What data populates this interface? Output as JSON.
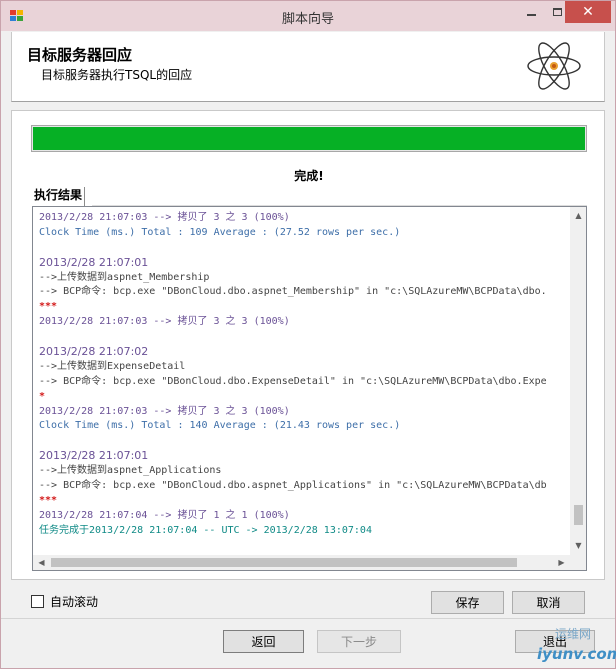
{
  "window": {
    "title": "脚本向导",
    "close_glyph": "✕"
  },
  "header": {
    "title": "目标服务器回应",
    "subtitle": "目标服务器执行TSQL的回应"
  },
  "progress": {
    "percent": 100,
    "color": "#06b025"
  },
  "status": "完成!",
  "tab": {
    "label": "执行结果"
  },
  "log": {
    "lines": [
      {
        "text": "2013/2/28 21:07:03 --> 拷贝了 3 之 3 (100%)",
        "color": "purple",
        "font": "mono"
      },
      {
        "text": "Clock Time (ms.) Total     : 109     Average : (27.52 rows per sec.)",
        "color": "blue",
        "font": "mono"
      },
      {
        "text": "",
        "color": "dark",
        "font": "mono"
      },
      {
        "text": "2013/2/28 21:07:01",
        "color": "purple",
        "font": "cjk"
      },
      {
        "text": " -->上传数据到aspnet_Membership",
        "color": "dark",
        "font": "mono"
      },
      {
        "text": " --> BCP命令:  bcp.exe \"DBonCloud.dbo.aspnet_Membership\" in \"c:\\SQLAzureMW\\BCPData\\dbo.",
        "color": "dark",
        "font": "mono"
      },
      {
        "text": "***",
        "color": "red",
        "font": "mono"
      },
      {
        "text": "2013/2/28 21:07:03 --> 拷贝了 3 之 3 (100%)",
        "color": "purple",
        "font": "mono"
      },
      {
        "text": "",
        "color": "dark",
        "font": "mono"
      },
      {
        "text": "2013/2/28 21:07:02",
        "color": "purple",
        "font": "cjk"
      },
      {
        "text": " -->上传数据到ExpenseDetail",
        "color": "dark",
        "font": "mono"
      },
      {
        "text": " --> BCP命令:  bcp.exe \"DBonCloud.dbo.ExpenseDetail\" in \"c:\\SQLAzureMW\\BCPData\\dbo.Expe",
        "color": "dark",
        "font": "mono"
      },
      {
        "text": "*",
        "color": "red",
        "font": "mono"
      },
      {
        "text": "2013/2/28 21:07:03 --> 拷贝了 3 之 3 (100%)",
        "color": "purple",
        "font": "mono"
      },
      {
        "text": "Clock Time (ms.) Total     : 140     Average : (21.43 rows per sec.)",
        "color": "blue",
        "font": "mono"
      },
      {
        "text": "",
        "color": "dark",
        "font": "mono"
      },
      {
        "text": "2013/2/28 21:07:01",
        "color": "purple",
        "font": "cjk"
      },
      {
        "text": " -->上传数据到aspnet_Applications",
        "color": "dark",
        "font": "mono"
      },
      {
        "text": " --> BCP命令:  bcp.exe \"DBonCloud.dbo.aspnet_Applications\" in \"c:\\SQLAzureMW\\BCPData\\db",
        "color": "dark",
        "font": "mono"
      },
      {
        "text": "***",
        "color": "red",
        "font": "mono"
      },
      {
        "text": "2013/2/28 21:07:04 --> 拷贝了 1 之 1 (100%)",
        "color": "purple",
        "font": "mono"
      },
      {
        "text": "任务完成于2013/2/28 21:07:04 -- UTC -> 2013/2/28 13:07:04",
        "color": "teal",
        "font": "mono"
      }
    ]
  },
  "scroll": {
    "up": "▲",
    "down": "▼",
    "left": "◀",
    "right": "▶"
  },
  "autoscroll": {
    "label": "自动滚动",
    "checked": false
  },
  "buttons": {
    "save": "保存",
    "cancel": "取消",
    "back": "返回",
    "next": "下一步",
    "exit": "退出"
  },
  "watermark": {
    "top": "运维网",
    "bottom": "iyunv.com"
  }
}
